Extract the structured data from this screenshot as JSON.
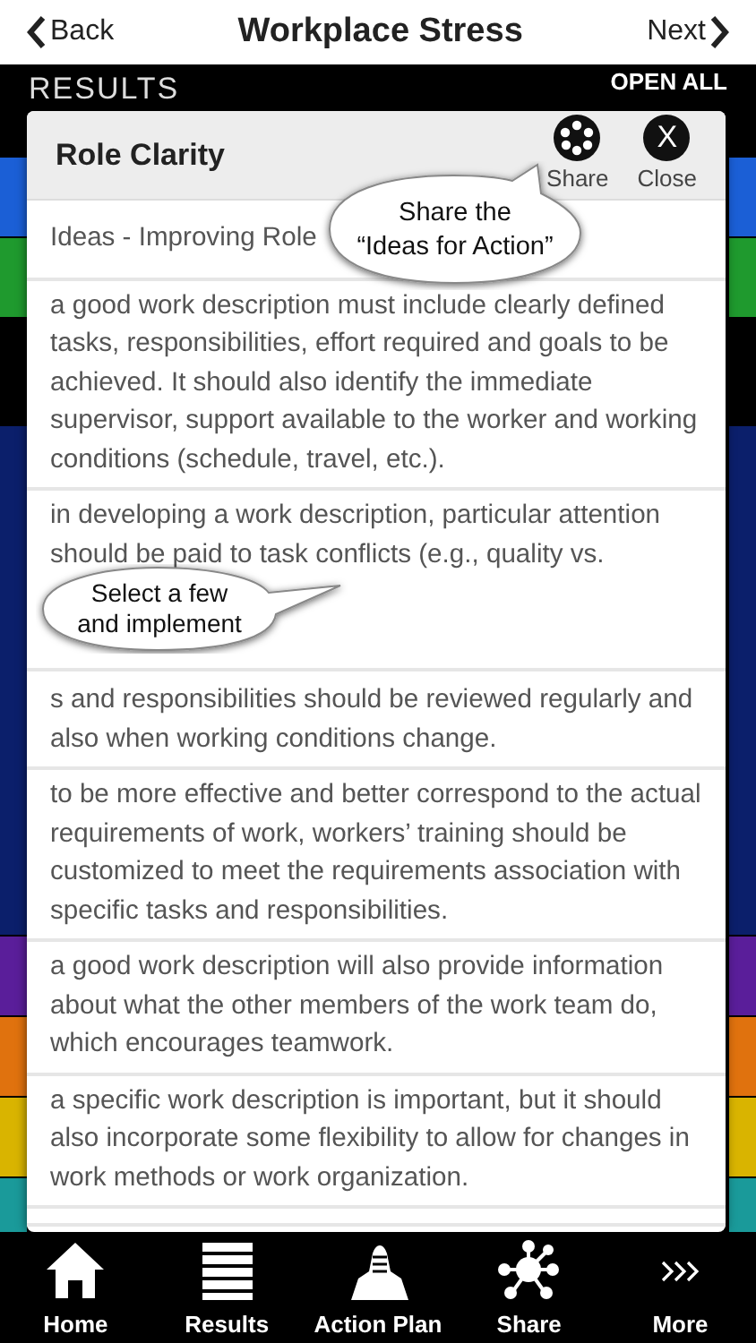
{
  "nav_bar": {
    "back": "Back",
    "title": "Workplace Stress",
    "next": "Next"
  },
  "results_header": {
    "title": "RESULTS",
    "open_all": "OPEN ALL"
  },
  "result_bars": [
    {
      "kind": "row",
      "color": "#1b5fd6"
    },
    {
      "kind": "row",
      "color": "#1f9a2e"
    },
    {
      "kind": "expanded",
      "color": "#0b1f6b"
    },
    {
      "kind": "row",
      "color": "#5a1e9a"
    },
    {
      "kind": "row",
      "color": "#e0720e"
    },
    {
      "kind": "row",
      "color": "#d9b400"
    },
    {
      "kind": "row",
      "color": "#1a9a9a"
    }
  ],
  "modal": {
    "title": "Role Clarity",
    "share_label": "Share",
    "close_symbol": "X",
    "close_label": "Close",
    "items": [
      {
        "kind": "heading",
        "text": "Ideas - Improving Role"
      },
      {
        "kind": "idea",
        "text": "a good work description must include clearly defined tasks, responsibilities, effort required and goals to be achieved. It should also identify the immediate supervisor, support available to the worker and working conditions (schedule, travel, etc.)."
      },
      {
        "kind": "cut",
        "text": "in developing a work description, particular attention should be paid to task conflicts (e.g., quality vs."
      },
      {
        "kind": "covered",
        "text": "s and responsibilities should be reviewed regularly and also when working conditions change."
      },
      {
        "kind": "idea",
        "text": "to be more effective and better correspond to the actual requirements of work, workers’ training should be customized to meet the requirements association with specific tasks and responsibilities."
      },
      {
        "kind": "idea",
        "text": "a good work description will also provide information about what the other members of the work team do, which encourages teamwork."
      },
      {
        "kind": "idea",
        "text": "a specific work description is important, but it should also incorporate some flexibility to allow for changes in work methods or work organization."
      },
      {
        "kind": "empty"
      }
    ]
  },
  "callouts": [
    {
      "kind": "share",
      "text": "Share the\n“Ideas for Action”"
    },
    {
      "kind": "select",
      "text": "Select a few\nand implement"
    }
  ],
  "tab_bar": [
    {
      "kind": "home",
      "label": "Home"
    },
    {
      "kind": "results",
      "label": "Results"
    },
    {
      "kind": "plan",
      "label": "Action Plan"
    },
    {
      "kind": "share",
      "label": "Share"
    },
    {
      "kind": "more",
      "label": "More"
    }
  ]
}
